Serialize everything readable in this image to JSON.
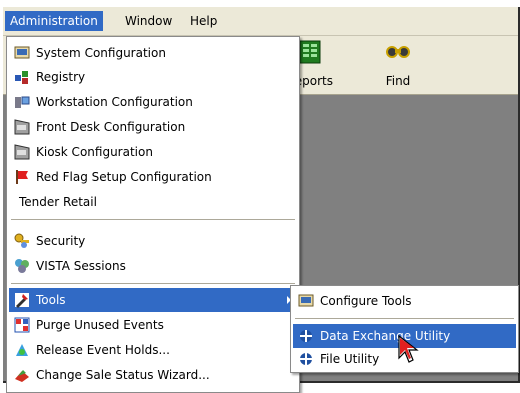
{
  "menubar": {
    "items": [
      "Administration",
      "Window",
      "Help"
    ]
  },
  "toolbar": {
    "reports_label": "Reports",
    "find_label": "Find"
  },
  "admin_menu": {
    "items": [
      {
        "label": "System Configuration",
        "icon": "system-config-icon"
      },
      {
        "label": "Registry",
        "icon": "registry-icon"
      },
      {
        "label": "Workstation Configuration",
        "icon": "workstation-icon"
      },
      {
        "label": "Front Desk Configuration",
        "icon": "front-desk-icon"
      },
      {
        "label": "Kiosk Configuration",
        "icon": "kiosk-icon"
      },
      {
        "label": "Red Flag Setup Configuration",
        "icon": "red-flag-icon"
      },
      {
        "label": "Tender Retail"
      },
      {
        "label": "Security",
        "icon": "security-keys-icon"
      },
      {
        "label": "VISTA Sessions",
        "icon": "sessions-icon"
      },
      {
        "label": "Tools",
        "icon": "tools-icon",
        "highlighted": true,
        "has_submenu": true
      },
      {
        "label": "Purge Unused Events",
        "icon": "purge-icon"
      },
      {
        "label": "Release Event Holds...",
        "icon": "release-holds-icon"
      },
      {
        "label": "Change Sale Status Wizard...",
        "icon": "wizard-icon"
      }
    ]
  },
  "tools_submenu": {
    "items": [
      {
        "label": "Configure Tools",
        "icon": "configure-tools-icon"
      },
      {
        "label": "Data Exchange Utility",
        "icon": "data-exchange-icon",
        "highlighted": true
      },
      {
        "label": "File Utility",
        "icon": "file-utility-icon"
      }
    ]
  },
  "colors": {
    "highlight": "#316ac5",
    "menubar": "#ece9d8",
    "workspace": "#808080"
  }
}
